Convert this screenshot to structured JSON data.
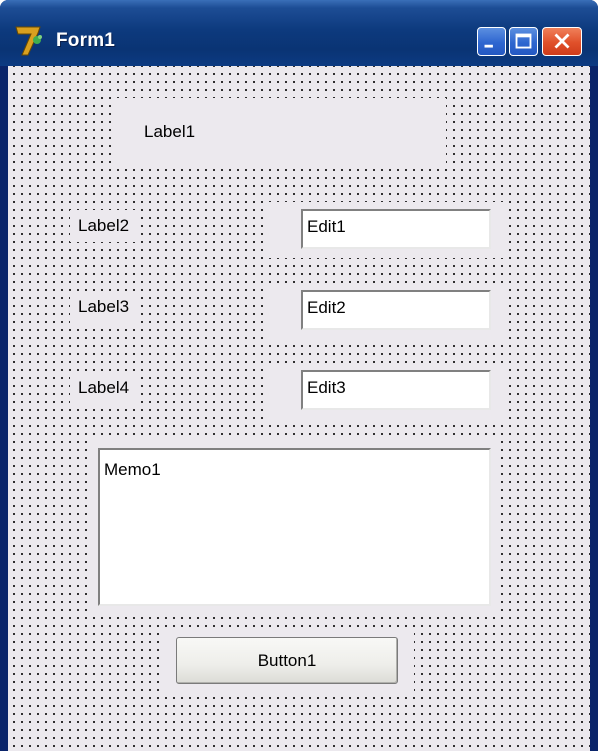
{
  "window": {
    "title": "Form1",
    "app_icon": "delphi-7-icon",
    "controls": {
      "minimize": "minimize-icon",
      "maximize": "maximize-icon",
      "close": "close-icon"
    }
  },
  "form": {
    "label1": "Label1",
    "label2": "Label2",
    "label3": "Label3",
    "label4": "Label4",
    "edit1": "Edit1",
    "edit2": "Edit2",
    "edit3": "Edit3",
    "memo1": "Memo1",
    "button1": "Button1"
  }
}
